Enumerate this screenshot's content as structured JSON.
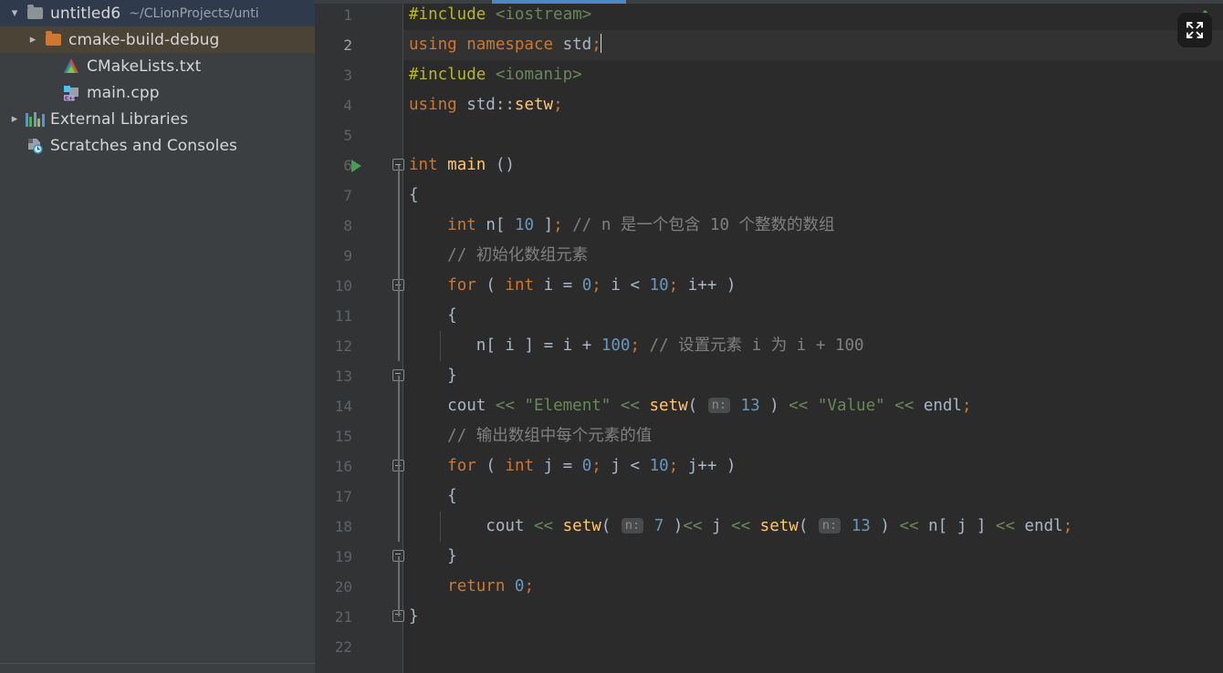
{
  "window": {
    "fullscreen_button_label": "fullscreen-toggle"
  },
  "sidebar": {
    "items": [
      {
        "label": "untitled6",
        "path": "~/CLionProjects/unti",
        "icon": "folder-icon",
        "arrow": "chevron-down-icon",
        "state": "selected",
        "indent": 0
      },
      {
        "label": "cmake-build-debug",
        "path": "",
        "icon": "folder-orange-icon",
        "arrow": "chevron-right-icon",
        "state": "hovered",
        "indent": 1
      },
      {
        "label": "CMakeLists.txt",
        "path": "",
        "icon": "cmake-file-icon",
        "arrow": "",
        "state": "normal",
        "indent": 2
      },
      {
        "label": "main.cpp",
        "path": "",
        "icon": "cpp-file-icon",
        "arrow": "",
        "state": "normal",
        "indent": 2
      },
      {
        "label": "External Libraries",
        "path": "",
        "icon": "libraries-icon",
        "arrow": "chevron-right-icon",
        "state": "normal",
        "indent": 0
      },
      {
        "label": "Scratches and Consoles",
        "path": "",
        "icon": "scratches-icon",
        "arrow": "",
        "state": "normal",
        "indent": 0
      }
    ]
  },
  "editor": {
    "current_line": 2,
    "total_lines": 22,
    "accent_color": "#4a88c7",
    "background": "#2b2b2b",
    "gutter_background": "#313335",
    "lines": [
      {
        "n": "1",
        "text": "#include <iostream>"
      },
      {
        "n": "2",
        "text": "using namespace std;"
      },
      {
        "n": "3",
        "text": "#include <iomanip>"
      },
      {
        "n": "4",
        "text": "using std::setw;"
      },
      {
        "n": "5",
        "text": ""
      },
      {
        "n": "6",
        "text": "int main ()"
      },
      {
        "n": "7",
        "text": "{"
      },
      {
        "n": "8",
        "text": "    int n[ 10 ]; // n 是一个包含 10 个整数的数组"
      },
      {
        "n": "9",
        "text": "    // 初始化数组元素"
      },
      {
        "n": "10",
        "text": "    for ( int i = 0; i < 10; i++ )"
      },
      {
        "n": "11",
        "text": "    {"
      },
      {
        "n": "12",
        "text": "       n[ i ] = i + 100; // 设置元素 i 为 i + 100"
      },
      {
        "n": "13",
        "text": "    }"
      },
      {
        "n": "14",
        "text": "    cout << \"Element\" << setw( n: 13 ) << \"Value\" << endl;"
      },
      {
        "n": "15",
        "text": "    // 输出数组中每个元素的值"
      },
      {
        "n": "16",
        "text": "    for ( int j = 0; j < 10; j++ )"
      },
      {
        "n": "17",
        "text": "    {"
      },
      {
        "n": "18",
        "text": "        cout << setw( n: 7 )<< j << setw( n: 13 ) << n[ j ] << endl;"
      },
      {
        "n": "19",
        "text": "    }"
      },
      {
        "n": "20",
        "text": "    return 0;"
      },
      {
        "n": "21",
        "text": "}"
      },
      {
        "n": "22",
        "text": ""
      }
    ],
    "parameter_hints": [
      {
        "line": "14",
        "name": "n:",
        "value": "13"
      },
      {
        "line": "18",
        "name": "n:",
        "value": "7"
      },
      {
        "line": "18",
        "name": "n:",
        "value": "13"
      }
    ],
    "gutter_icons": [
      {
        "line": "6",
        "icon": "run-main-icon"
      },
      {
        "line": "6",
        "icon": "fold-collapse-icon"
      },
      {
        "line": "10",
        "icon": "fold-collapse-icon"
      },
      {
        "line": "13",
        "icon": "fold-expand-end-icon"
      },
      {
        "line": "16",
        "icon": "fold-collapse-icon"
      },
      {
        "line": "19",
        "icon": "fold-expand-end-icon"
      },
      {
        "line": "21",
        "icon": "fold-expand-end-icon"
      }
    ],
    "syntax_colors": {
      "keyword": "#cc7832",
      "preprocessor": "#bbb529",
      "string": "#6a8759",
      "number": "#6897bb",
      "comment": "#808080",
      "identifier": "#a9b7c6",
      "function": "#ffc66d"
    }
  }
}
